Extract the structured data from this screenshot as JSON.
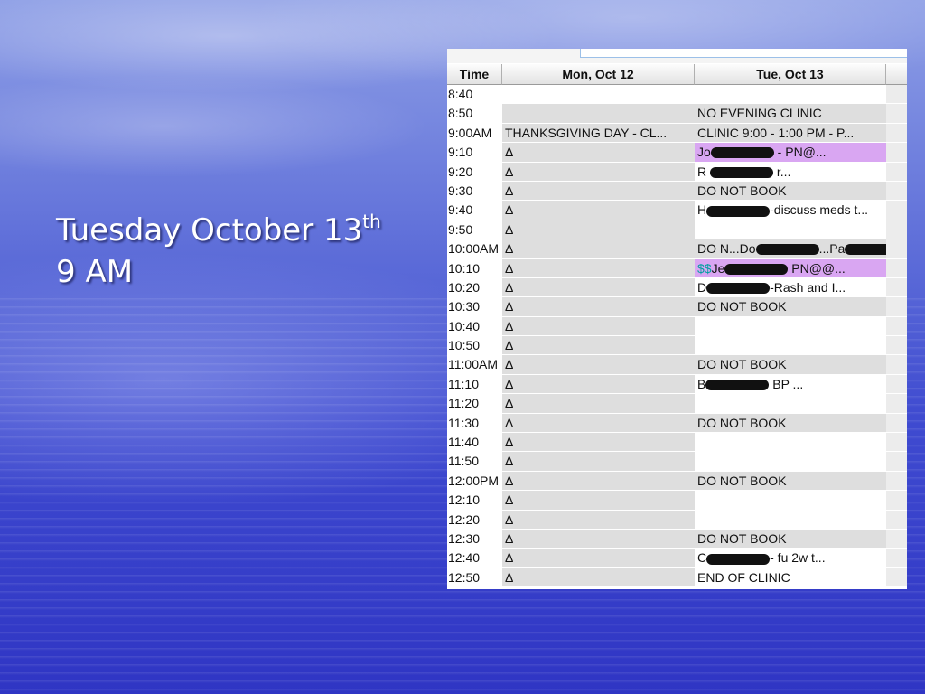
{
  "slide": {
    "title_line": "Tuesday October 13",
    "title_sup": "th",
    "time_line": "9 AM"
  },
  "schedule": {
    "columns": {
      "time": "Time",
      "mon": "Mon, Oct 12",
      "tue": "Tue, Oct 13"
    },
    "rows": [
      {
        "time": "8:40",
        "mon": "",
        "tue": "",
        "mon_bg": "white",
        "tue_bg": "white"
      },
      {
        "time": "8:50",
        "mon": "",
        "tue": "NO EVENING CLINIC",
        "mon_bg": "gray",
        "tue_bg": "gray"
      },
      {
        "time": "9:00AM",
        "mon": "THANKSGIVING DAY - CL...",
        "tue": "CLINIC  9:00 - 1:00 PM - P...",
        "mon_bg": "gray",
        "tue_bg": "gray"
      },
      {
        "time": "9:10",
        "mon": "Δ",
        "tue": "Jo[redacted] - PN@...",
        "mon_bg": "gray",
        "tue_bg": "purple"
      },
      {
        "time": "9:20",
        "mon": "Δ",
        "tue": "R [redacted]     r...",
        "mon_bg": "gray",
        "tue_bg": "white"
      },
      {
        "time": "9:30",
        "mon": "Δ",
        "tue": "DO NOT BOOK",
        "mon_bg": "gray",
        "tue_bg": "gray"
      },
      {
        "time": "9:40",
        "mon": "Δ",
        "tue": "H[redacted]-discuss meds    t...",
        "mon_bg": "gray",
        "tue_bg": "white"
      },
      {
        "time": "9:50",
        "mon": "Δ",
        "tue": "",
        "mon_bg": "gray",
        "tue_bg": "white"
      },
      {
        "time": "10:00AM",
        "mon": "Δ",
        "tue": "DO N...Do[redacted]...Pa[redacted]",
        "mon_bg": "gray",
        "tue_bg": "gray"
      },
      {
        "time": "10:10",
        "mon": "Δ",
        "tue": "$$Je[redacted] PN@@...",
        "mon_bg": "gray",
        "tue_bg": "purple"
      },
      {
        "time": "10:20",
        "mon": "Δ",
        "tue": "D[redacted]-Rash and I...",
        "mon_bg": "gray",
        "tue_bg": "white"
      },
      {
        "time": "10:30",
        "mon": "Δ",
        "tue": "DO NOT BOOK",
        "mon_bg": "gray",
        "tue_bg": "gray"
      },
      {
        "time": "10:40",
        "mon": "Δ",
        "tue": "",
        "mon_bg": "gray",
        "tue_bg": "white"
      },
      {
        "time": "10:50",
        "mon": "Δ",
        "tue": "",
        "mon_bg": "gray",
        "tue_bg": "white"
      },
      {
        "time": "11:00AM",
        "mon": "Δ",
        "tue": "DO NOT BOOK",
        "mon_bg": "gray",
        "tue_bg": "gray"
      },
      {
        "time": "11:10",
        "mon": "Δ",
        "tue": "B[redacted] BP ...",
        "mon_bg": "gray",
        "tue_bg": "white"
      },
      {
        "time": "11:20",
        "mon": "Δ",
        "tue": "",
        "mon_bg": "gray",
        "tue_bg": "white"
      },
      {
        "time": "11:30",
        "mon": "Δ",
        "tue": "DO NOT BOOK",
        "mon_bg": "gray",
        "tue_bg": "gray"
      },
      {
        "time": "11:40",
        "mon": "Δ",
        "tue": "",
        "mon_bg": "gray",
        "tue_bg": "white"
      },
      {
        "time": "11:50",
        "mon": "Δ",
        "tue": "",
        "mon_bg": "gray",
        "tue_bg": "white"
      },
      {
        "time": "12:00PM",
        "mon": "Δ",
        "tue": "DO NOT BOOK",
        "mon_bg": "gray",
        "tue_bg": "gray"
      },
      {
        "time": "12:10",
        "mon": "Δ",
        "tue": "",
        "mon_bg": "gray",
        "tue_bg": "white"
      },
      {
        "time": "12:20",
        "mon": "Δ",
        "tue": "",
        "mon_bg": "gray",
        "tue_bg": "white"
      },
      {
        "time": "12:30",
        "mon": "Δ",
        "tue": "DO NOT BOOK",
        "mon_bg": "gray",
        "tue_bg": "gray"
      },
      {
        "time": "12:40",
        "mon": "Δ",
        "tue": "C[redacted]- fu 2w          t...",
        "mon_bg": "gray",
        "tue_bg": "white"
      },
      {
        "time": "12:50",
        "mon": "Δ",
        "tue": "END OF CLINIC",
        "mon_bg": "gray",
        "tue_bg": "white"
      }
    ]
  },
  "colors": {
    "purple_highlight": "#d9a6f2",
    "gray_cell": "#dedede",
    "money_symbol": "#00a0a0"
  }
}
